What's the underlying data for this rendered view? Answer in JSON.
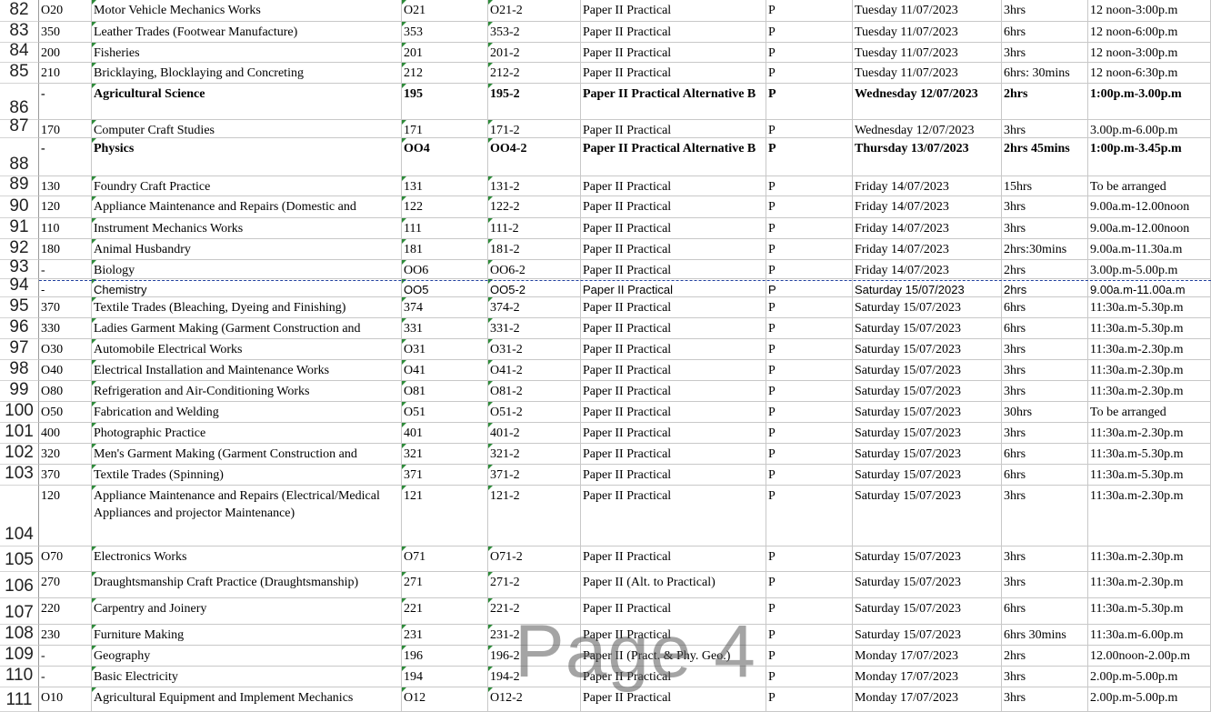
{
  "rows": [
    {
      "num": "82",
      "code": "O20",
      "subject": "Motor  Vehicle Mechanics Works",
      "paper_code": "O21",
      "paper_no": "O21-2",
      "paper": "Paper II Practical",
      "type": "P",
      "date": "Tuesday  11/07/2023",
      "duration": "3hrs",
      "time": "12 noon-3:00p.m"
    },
    {
      "num": "83",
      "code": "350",
      "subject": "Leather Trades (Footwear Manufacture)",
      "paper_code": "353",
      "paper_no": "353-2",
      "paper": "Paper II Practical",
      "type": "P",
      "date": "Tuesday  11/07/2023",
      "duration": "6hrs",
      "time": "12 noon-6:00p.m"
    },
    {
      "num": "84",
      "code": "200",
      "subject": "Fisheries",
      "paper_code": "201",
      "paper_no": "201-2",
      "paper": "Paper II Practical",
      "type": "P",
      "date": "Tuesday  11/07/2023",
      "duration": "3hrs",
      "time": "12 noon-3:00p.m"
    },
    {
      "num": "85",
      "code": "210",
      "subject": "Bricklaying, Blocklaying and Concreting",
      "paper_code": "212",
      "paper_no": "212-2",
      "paper": "Paper II Practical",
      "type": "P",
      "date": "Tuesday  11/07/2023",
      "duration": "6hrs: 30mins",
      "time": "12 noon-6:30p.m"
    },
    {
      "num": "86",
      "code": "-",
      "subject": "Agricultural Science",
      "paper_code": "195",
      "paper_no": "195-2",
      "paper": "Paper II Practical Alternative B",
      "type": "P",
      "date": "Wednesday 12/07/2023",
      "duration": "2hrs",
      "time": "1:00p.m-3.00p.m"
    },
    {
      "num": "87",
      "code": "170",
      "subject": "Computer Craft Studies",
      "paper_code": "171",
      "paper_no": "171-2",
      "paper": "Paper II Practical",
      "type": "P",
      "date": "Wednesday 12/07/2023",
      "duration": "3hrs",
      "time": "3.00p.m-6.00p.m"
    },
    {
      "num": "88",
      "code": "-",
      "subject": "Physics",
      "paper_code": "OO4",
      "paper_no": "OO4-2",
      "paper": "Paper II Practical  Alternative B",
      "type": "P",
      "date": "Thursday 13/07/2023",
      "duration": "2hrs 45mins",
      "time": "1:00p.m-3.45p.m"
    },
    {
      "num": "89",
      "code": "130",
      "subject": "Foundry Craft Practice",
      "paper_code": "131",
      "paper_no": "131-2",
      "paper": "Paper II Practical",
      "type": "P",
      "date": "Friday 14/07/2023",
      "duration": "15hrs",
      "time": "To be arranged"
    },
    {
      "num": "90",
      "code": "120",
      "subject": "Appliance Maintenance and Repairs (Domestic and",
      "paper_code": "122",
      "paper_no": "122-2",
      "paper": "Paper II Practical",
      "type": "P",
      "date": "Friday 14/07/2023",
      "duration": "3hrs",
      "time": "9.00a.m-12.00noon"
    },
    {
      "num": "91",
      "code": "110",
      "subject": "Instrument Mechanics Works",
      "paper_code": "111",
      "paper_no": "111-2",
      "paper": "Paper II Practical",
      "type": "P",
      "date": "Friday 14/07/2023",
      "duration": "3hrs",
      "time": "9.00a.m-12.00noon"
    },
    {
      "num": "92",
      "code": "180",
      "subject": "Animal Husbandry",
      "paper_code": "181",
      "paper_no": "181-2",
      "paper": "Paper II Practical",
      "type": "P",
      "date": "Friday 14/07/2023",
      "duration": "2hrs:30mins",
      "time": "9.00a.m-11.30a.m"
    },
    {
      "num": "93",
      "code": "-",
      "subject": "Biology",
      "paper_code": "OO6",
      "paper_no": "OO6-2",
      "paper": "Paper II Practical",
      "type": "P",
      "date": "Friday 14/07/2023",
      "duration": "2hrs",
      "time": "3.00p.m-5.00p.m"
    },
    {
      "num": "94",
      "code": "-",
      "subject": "Chemistry",
      "paper_code": "OO5",
      "paper_no": "OO5-2",
      "paper": "Paper II Practical",
      "type": "P",
      "date": "Saturday 15/07/2023",
      "duration": "2hrs",
      "time": "9.00a.m-11.00a.m"
    },
    {
      "num": "95",
      "code": "370",
      "subject": "Textile Trades (Bleaching, Dyeing and Finishing)",
      "paper_code": "374",
      "paper_no": "374-2",
      "paper": "Paper II Practical",
      "type": "P",
      "date": "Saturday 15/07/2023",
      "duration": "6hrs",
      "time": "11:30a.m-5.30p.m"
    },
    {
      "num": "96",
      "code": "330",
      "subject": "Ladies Garment Making (Garment Construction and",
      "paper_code": "331",
      "paper_no": "331-2",
      "paper": "Paper II Practical",
      "type": "P",
      "date": "Saturday 15/07/2023",
      "duration": "6hrs",
      "time": "11:30a.m-5.30p.m"
    },
    {
      "num": "97",
      "code": "O30",
      "subject": "Automobile Electrical Works",
      "paper_code": "O31",
      "paper_no": "O31-2",
      "paper": "Paper II Practical",
      "type": "P",
      "date": "Saturday 15/07/2023",
      "duration": "3hrs",
      "time": "11:30a.m-2.30p.m"
    },
    {
      "num": "98",
      "code": "O40",
      "subject": "Electrical Installation and Maintenance Works",
      "paper_code": "O41",
      "paper_no": "O41-2",
      "paper": "Paper II Practical",
      "type": "P",
      "date": "Saturday 15/07/2023",
      "duration": "3hrs",
      "time": "11:30a.m-2.30p.m"
    },
    {
      "num": "99",
      "code": "O80",
      "subject": "Refrigeration and Air-Conditioning Works",
      "paper_code": "O81",
      "paper_no": "O81-2",
      "paper": "Paper II Practical",
      "type": "P",
      "date": "Saturday 15/07/2023",
      "duration": "3hrs",
      "time": "11:30a.m-2.30p.m"
    },
    {
      "num": "100",
      "code": "O50",
      "subject": "Fabrication and Welding",
      "paper_code": "O51",
      "paper_no": "O51-2",
      "paper": "Paper II Practical",
      "type": "P",
      "date": "Saturday 15/07/2023",
      "duration": "30hrs",
      "time": "To be arranged"
    },
    {
      "num": "101",
      "code": "400",
      "subject": "Photographic Practice",
      "paper_code": "401",
      "paper_no": "401-2",
      "paper": "Paper II Practical",
      "type": "P",
      "date": "Saturday 15/07/2023",
      "duration": "3hrs",
      "time": "11:30a.m-2.30p.m"
    },
    {
      "num": "102",
      "code": "320",
      "subject": "Men's Garment Making (Garment Construction and",
      "paper_code": "321",
      "paper_no": "321-2",
      "paper": "Paper II Practical",
      "type": "P",
      "date": "Saturday 15/07/2023",
      "duration": "6hrs",
      "time": "11:30a.m-5.30p.m"
    },
    {
      "num": "103",
      "code": "370",
      "subject": "Textile Trades (Spinning)",
      "paper_code": "371",
      "paper_no": "371-2",
      "paper": "Paper II Practical",
      "type": "P",
      "date": "Saturday 15/07/2023",
      "duration": "6hrs",
      "time": "11:30a.m-5.30p.m"
    },
    {
      "num": "104",
      "code": "120",
      "subject": "Appliance Maintenance and Repairs (Electrical/Medical Appliances and projector Maintenance)",
      "paper_code": "121",
      "paper_no": "121-2",
      "paper": "Paper II Practical",
      "type": "P",
      "date": "Saturday 15/07/2023",
      "duration": "3hrs",
      "time": "11:30a.m-2.30p.m"
    },
    {
      "num": "105",
      "code": "O70",
      "subject": "Electronics Works",
      "paper_code": "O71",
      "paper_no": "O71-2",
      "paper": "Paper II Practical",
      "type": "P",
      "date": "Saturday 15/07/2023",
      "duration": "3hrs",
      "time": "11:30a.m-2.30p.m"
    },
    {
      "num": "106",
      "code": "270",
      "subject": "Draughtsmanship Craft Practice (Draughtsmanship)",
      "paper_code": "271",
      "paper_no": "271-2",
      "paper": "Paper II (Alt. to Practical)",
      "type": "P",
      "date": "Saturday  15/07/2023",
      "duration": "3hrs",
      "time": "11:30a.m-2.30p.m"
    },
    {
      "num": "107",
      "code": "220",
      "subject": "Carpentry and Joinery",
      "paper_code": "221",
      "paper_no": "221-2",
      "paper": "Paper II Practical",
      "type": "P",
      "date": "Saturday  15/07/2023",
      "duration": "6hrs",
      "time": "11:30a.m-5.30p.m"
    },
    {
      "num": "108",
      "code": "230",
      "subject": "Furniture Making",
      "paper_code": "231",
      "paper_no": "231-2",
      "paper": "Paper II Practical",
      "type": "P",
      "date": "Saturday  15/07/2023",
      "duration": "6hrs 30mins",
      "time": "11:30a.m-6.00p.m"
    },
    {
      "num": "109",
      "code": "-",
      "subject": "Geography",
      "paper_code": "196",
      "paper_no": "196-2",
      "paper": "Paper II (Pract. & Phy. Geo.)",
      "type": "P",
      "date": "Monday 17/07/2023",
      "duration": "2hrs",
      "time": "12.00noon-2.00p.m"
    },
    {
      "num": "110",
      "code": "-",
      "subject": "Basic Electricity",
      "paper_code": "194",
      "paper_no": "194-2",
      "paper": "Paper II Practical",
      "type": "P",
      "date": "Monday 17/07/2023",
      "duration": "3hrs",
      "time": "2.00p.m-5.00p.m"
    },
    {
      "num": "111",
      "code": "O10",
      "subject": "Agricultural Equipment and  Implement Mechanics",
      "paper_code": "O12",
      "paper_no": "O12-2",
      "paper": "Paper II Practical",
      "type": "P",
      "date": "Monday 17/07/2023",
      "duration": "3hrs",
      "time": "2.00p.m-5.00p.m"
    }
  ],
  "watermark": "Page 4"
}
